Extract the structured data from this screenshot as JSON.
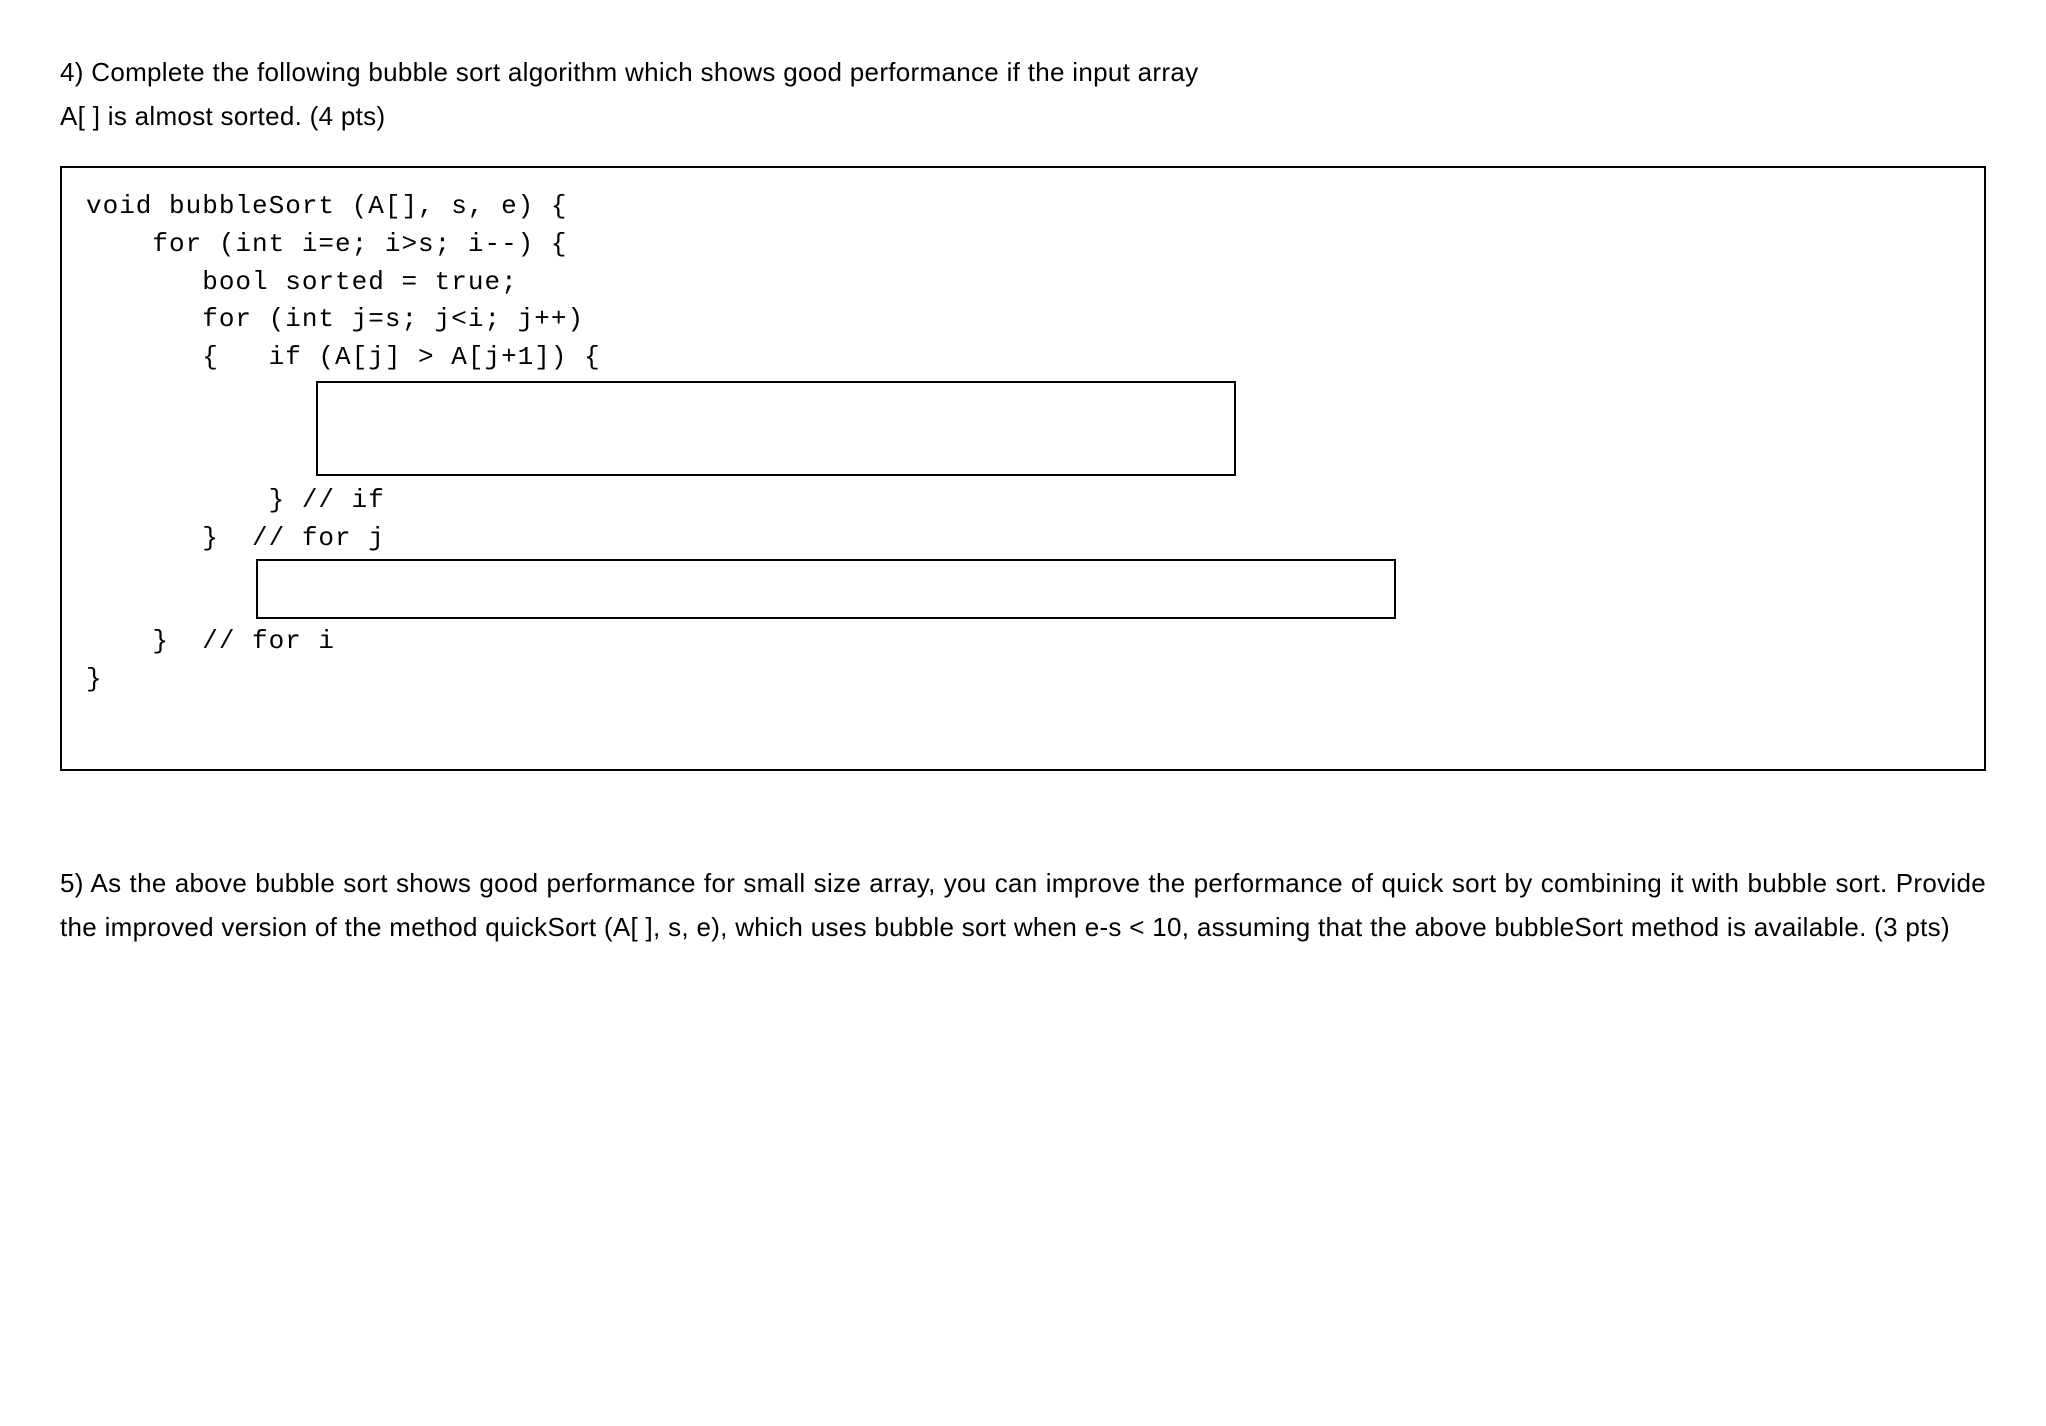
{
  "q4": {
    "prompt_line1": "4) Complete the following bubble sort algorithm which shows good performance if the input array",
    "prompt_line2": "A[ ] is almost sorted. (4 pts)",
    "code": {
      "l1": "void bubbleSort (A[], s, e) {",
      "l2": "",
      "l3": "    for (int i=e; i>s; i--) {",
      "l4": "       bool sorted = true;",
      "l5": "       for (int j=s; j<i; j++)",
      "l6": "       {   if (A[j] > A[j+1]) {",
      "l7": "           } // if",
      "l8": "       }  // for j",
      "l9": "    }  // for i",
      "l10": "}"
    }
  },
  "q5": {
    "prompt": "5) As the above bubble sort shows good performance for small size array, you can improve the performance of quick sort by combining it with bubble sort.  Provide the improved version of the method quickSort (A[ ], s, e), which uses bubble sort when e-s < 10, assuming that the above bubbleSort method is available. (3 pts)"
  }
}
